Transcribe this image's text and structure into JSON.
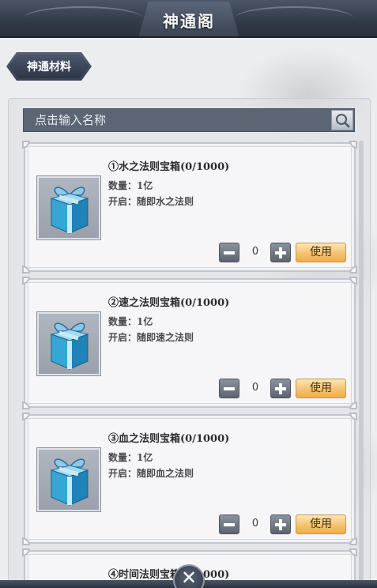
{
  "header": {
    "title": "神通阁"
  },
  "category_tab": {
    "label": "神通材料"
  },
  "search": {
    "placeholder": "点击输入名称"
  },
  "items": [
    {
      "name": "①水之法则宝箱(0/1000)",
      "quantity": "数量：1亿",
      "open": "开启：随即水之法则",
      "count": "0",
      "use_label": "使用"
    },
    {
      "name": "②速之法则宝箱(0/1000)",
      "quantity": "数量：1亿",
      "open": "开启：随即速之法则",
      "count": "0",
      "use_label": "使用"
    },
    {
      "name": "③血之法则宝箱(0/1000)",
      "quantity": "数量：1亿",
      "open": "开启：随即血之法则",
      "count": "0",
      "use_label": "使用"
    },
    {
      "name": "④时间法则宝箱(0/1000)"
    }
  ],
  "icons": {
    "search": "magnifier-icon",
    "close": "close-x-icon",
    "item": "gift-box-icon"
  },
  "colors": {
    "title_bar": "#323b48",
    "use_button": "#f4c270",
    "search_bar": "#5b6573"
  }
}
